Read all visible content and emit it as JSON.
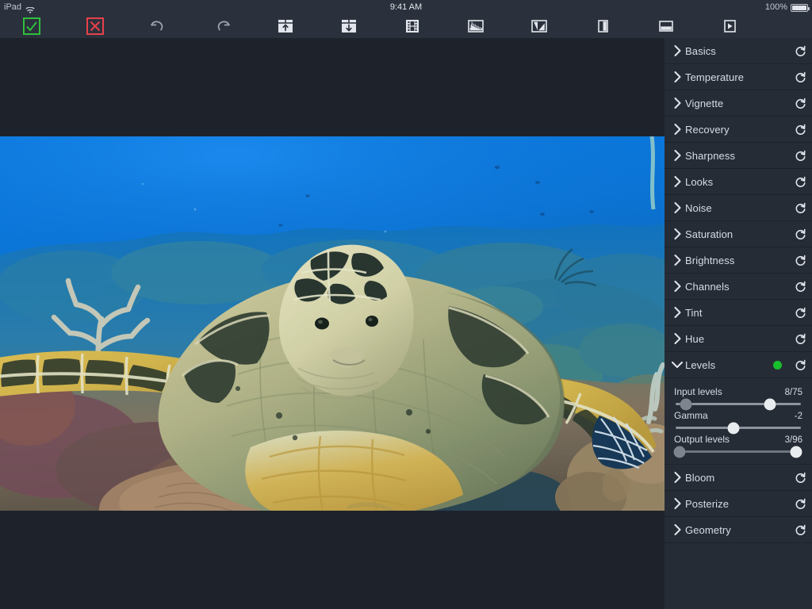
{
  "status_bar": {
    "device": "iPad",
    "wifi_icon": "wifi-icon",
    "time": "9:41 AM",
    "battery_percent": "100%",
    "battery_icon": "battery-full-icon"
  },
  "toolbar": {
    "buttons": [
      {
        "name": "accept-button",
        "icon": "checkmark-box-icon",
        "color": "#2fbf3c"
      },
      {
        "name": "cancel-button",
        "icon": "x-box-icon",
        "color": "#e8404a"
      },
      {
        "name": "undo-button",
        "icon": "undo-arrow-icon",
        "color": "#9aa2ad"
      },
      {
        "name": "redo-button",
        "icon": "redo-arrow-icon",
        "color": "#9aa2ad"
      },
      {
        "name": "import-button",
        "icon": "box-arrow-up-icon",
        "color": "#e2e6ec"
      },
      {
        "name": "export-button",
        "icon": "box-arrow-down-icon",
        "color": "#e2e6ec"
      },
      {
        "name": "filmstrip-button",
        "icon": "filmstrip-icon",
        "color": "#e2e6ec"
      },
      {
        "name": "histogram-button",
        "icon": "histogram-icon",
        "color": "#e2e6ec"
      },
      {
        "name": "curves-button",
        "icon": "curves-triangle-icon",
        "color": "#e2e6ec"
      },
      {
        "name": "split-view-button",
        "icon": "split-vertical-icon",
        "color": "#e2e6ec"
      },
      {
        "name": "compare-button",
        "icon": "split-horizontal-icon",
        "color": "#e2e6ec"
      },
      {
        "name": "play-button",
        "icon": "play-box-icon",
        "color": "#e2e6ec"
      }
    ]
  },
  "canvas": {
    "photo_alt": "Hawksbill sea turtle swimming over a coral reef in blue water",
    "background_color": "#1e232b"
  },
  "sidebar": {
    "accent_color": "#19bf2c",
    "reset_icon": "reset-circular-arrow-icon",
    "collapsed_chevron": "chevron-right-icon",
    "expanded_chevron": "chevron-down-icon",
    "items": [
      {
        "label": "Basics",
        "expanded": false,
        "active": false
      },
      {
        "label": "Temperature",
        "expanded": false,
        "active": false
      },
      {
        "label": "Vignette",
        "expanded": false,
        "active": false
      },
      {
        "label": "Recovery",
        "expanded": false,
        "active": false
      },
      {
        "label": "Sharpness",
        "expanded": false,
        "active": false
      },
      {
        "label": "Looks",
        "expanded": false,
        "active": false
      },
      {
        "label": "Noise",
        "expanded": false,
        "active": false
      },
      {
        "label": "Saturation",
        "expanded": false,
        "active": false
      },
      {
        "label": "Brightness",
        "expanded": false,
        "active": false
      },
      {
        "label": "Channels",
        "expanded": false,
        "active": false
      },
      {
        "label": "Tint",
        "expanded": false,
        "active": false
      },
      {
        "label": "Hue",
        "expanded": false,
        "active": false
      },
      {
        "label": "Levels",
        "expanded": true,
        "active": true
      },
      {
        "label": "Bloom",
        "expanded": false,
        "active": false
      },
      {
        "label": "Posterize",
        "expanded": false,
        "active": false
      },
      {
        "label": "Geometry",
        "expanded": false,
        "active": false
      }
    ],
    "levels": {
      "title": "Levels",
      "sliders": [
        {
          "label": "Input levels",
          "value": "8/75",
          "knobs": [
            {
              "pos_percent": 8,
              "style": "dark"
            },
            {
              "pos_percent": 75,
              "style": "light"
            }
          ]
        },
        {
          "label": "Gamma",
          "value": "-2",
          "knobs": [
            {
              "pos_percent": 46,
              "style": "light"
            }
          ]
        },
        {
          "label": "Output levels",
          "value": "3/96",
          "knobs": [
            {
              "pos_percent": 3,
              "style": "dark"
            },
            {
              "pos_percent": 96,
              "style": "light"
            }
          ]
        }
      ]
    }
  }
}
